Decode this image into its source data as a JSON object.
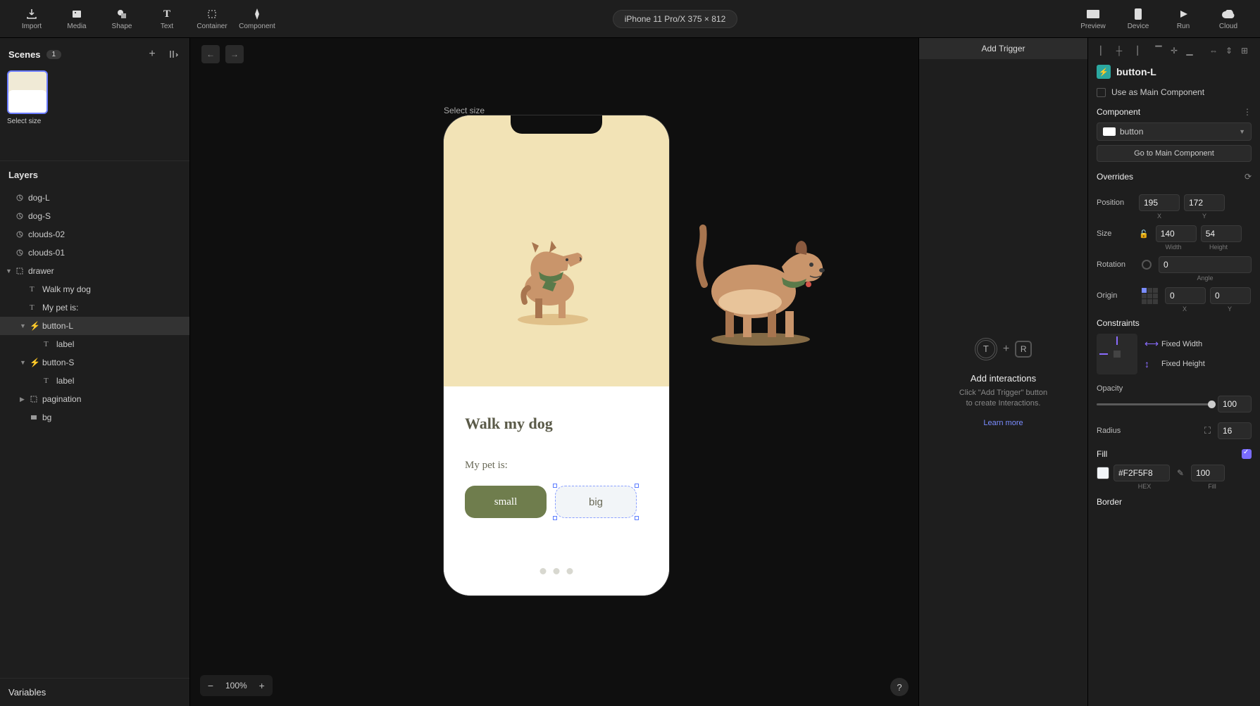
{
  "toolbar": {
    "tools": [
      {
        "label": "Import",
        "icon": "import"
      },
      {
        "label": "Media",
        "icon": "media"
      },
      {
        "label": "Shape",
        "icon": "shape"
      },
      {
        "label": "Text",
        "icon": "text"
      },
      {
        "label": "Container",
        "icon": "container"
      },
      {
        "label": "Component",
        "icon": "component"
      }
    ],
    "device": "iPhone 11 Pro/X  375 × 812",
    "right": [
      {
        "label": "Preview",
        "icon": "preview"
      },
      {
        "label": "Device",
        "icon": "device"
      },
      {
        "label": "Run",
        "icon": "run"
      },
      {
        "label": "Cloud",
        "icon": "cloud"
      }
    ]
  },
  "scenes": {
    "title": "Scenes",
    "count": "1",
    "thumb_name": "Select size"
  },
  "layers": {
    "title": "Layers",
    "items": [
      {
        "name": "dog-L",
        "icon": "anim",
        "indent": 0
      },
      {
        "name": "dog-S",
        "icon": "anim",
        "indent": 0
      },
      {
        "name": "clouds-02",
        "icon": "anim",
        "indent": 0
      },
      {
        "name": "clouds-01",
        "icon": "anim",
        "indent": 0
      },
      {
        "name": "drawer",
        "icon": "container",
        "indent": 0,
        "caret": "▼"
      },
      {
        "name": "Walk my dog",
        "icon": "text",
        "indent": 1
      },
      {
        "name": "My pet is:",
        "icon": "text",
        "indent": 1
      },
      {
        "name": "button-L",
        "icon": "bolt",
        "indent": 1,
        "caret": "▼",
        "selected": true
      },
      {
        "name": "label",
        "icon": "text",
        "indent": 2
      },
      {
        "name": "button-S",
        "icon": "bolt",
        "indent": 1,
        "caret": "▼"
      },
      {
        "name": "label",
        "icon": "text",
        "indent": 2
      },
      {
        "name": "pagination",
        "icon": "container",
        "indent": 1,
        "caret": "▶"
      },
      {
        "name": "bg",
        "icon": "rect",
        "indent": 1
      }
    ]
  },
  "variables_title": "Variables",
  "canvas": {
    "frame_label": "Select size",
    "drawer_title": "Walk my dog",
    "drawer_sub": "My pet is:",
    "btn_small": "small",
    "btn_big": "big",
    "zoom": "100%"
  },
  "interactions": {
    "add_trigger": "Add Trigger",
    "t_letter": "T",
    "plus": "+",
    "r_letter": "R",
    "title": "Add interactions",
    "desc1": "Click \"Add Trigger\" button",
    "desc2": "to create Interactions.",
    "link": "Learn more"
  },
  "inspector": {
    "component_name": "button-L",
    "use_main": "Use as Main Component",
    "component_section": "Component",
    "component_value": "button",
    "goto": "Go to Main Component",
    "overrides": "Overrides",
    "position_label": "Position",
    "pos_x": "195",
    "pos_y": "172",
    "x_label": "X",
    "y_label": "Y",
    "size_label": "Size",
    "width": "140",
    "height": "54",
    "width_label": "Width",
    "height_label": "Height",
    "rotation_label": "Rotation",
    "rotation": "0",
    "angle_label": "Angle",
    "origin_label": "Origin",
    "origin_x": "0",
    "origin_y": "0",
    "constraints_label": "Constraints",
    "fixed_width": "Fixed Width",
    "fixed_height": "Fixed Height",
    "opacity_label": "Opacity",
    "opacity": "100",
    "radius_label": "Radius",
    "radius": "16",
    "fill_label": "Fill",
    "fill_hex": "#F2F5F8",
    "fill_pct": "100",
    "hex_label": "HEX",
    "fill_sub": "Fill",
    "border_label": "Border"
  }
}
